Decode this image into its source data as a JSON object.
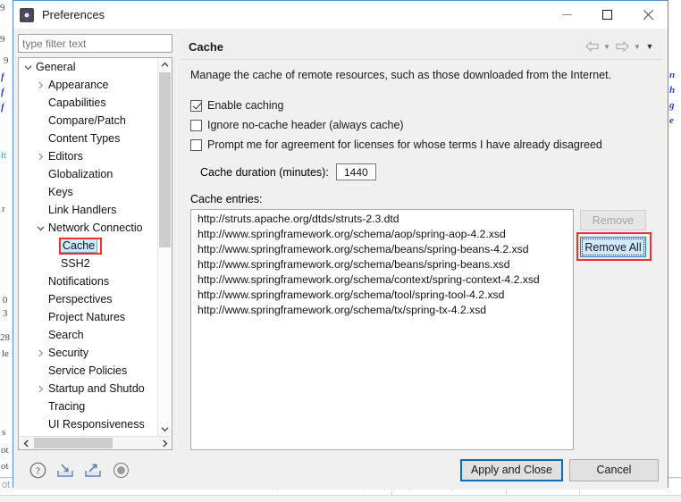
{
  "window": {
    "title": "Preferences",
    "icon": "preferences-gear-icon",
    "minimize_label": "–",
    "maximize_label": "□",
    "close_label": "✕"
  },
  "sidebar": {
    "filter_placeholder": "type filter text",
    "filter_value": "",
    "items": [
      {
        "label": "General",
        "indent": 0,
        "twisty": "expanded",
        "selected": false
      },
      {
        "label": "Appearance",
        "indent": 1,
        "twisty": "collapsed",
        "selected": false
      },
      {
        "label": "Capabilities",
        "indent": 1,
        "twisty": "none",
        "selected": false
      },
      {
        "label": "Compare/Patch",
        "indent": 1,
        "twisty": "none",
        "selected": false
      },
      {
        "label": "Content Types",
        "indent": 1,
        "twisty": "none",
        "selected": false
      },
      {
        "label": "Editors",
        "indent": 1,
        "twisty": "collapsed",
        "selected": false
      },
      {
        "label": "Globalization",
        "indent": 1,
        "twisty": "none",
        "selected": false
      },
      {
        "label": "Keys",
        "indent": 1,
        "twisty": "none",
        "selected": false
      },
      {
        "label": "Link Handlers",
        "indent": 1,
        "twisty": "none",
        "selected": false
      },
      {
        "label": "Network Connectio",
        "indent": 1,
        "twisty": "expanded",
        "selected": false
      },
      {
        "label": "Cache",
        "indent": 2,
        "twisty": "none",
        "selected": true
      },
      {
        "label": "SSH2",
        "indent": 2,
        "twisty": "none",
        "selected": false
      },
      {
        "label": "Notifications",
        "indent": 1,
        "twisty": "none",
        "selected": false
      },
      {
        "label": "Perspectives",
        "indent": 1,
        "twisty": "none",
        "selected": false
      },
      {
        "label": "Project Natures",
        "indent": 1,
        "twisty": "none",
        "selected": false
      },
      {
        "label": "Search",
        "indent": 1,
        "twisty": "none",
        "selected": false
      },
      {
        "label": "Security",
        "indent": 1,
        "twisty": "collapsed",
        "selected": false
      },
      {
        "label": "Service Policies",
        "indent": 1,
        "twisty": "none",
        "selected": false
      },
      {
        "label": "Startup and Shutdo",
        "indent": 1,
        "twisty": "collapsed",
        "selected": false
      },
      {
        "label": "Tracing",
        "indent": 1,
        "twisty": "none",
        "selected": false
      },
      {
        "label": "UI Responsiveness",
        "indent": 1,
        "twisty": "none",
        "selected": false
      }
    ]
  },
  "page": {
    "title": "Cache",
    "nav": {
      "back_icon": "back-arrow-icon",
      "back_caret": "▼",
      "forward_icon": "forward-arrow-icon",
      "forward_caret": "▼",
      "menu_caret": "▼"
    },
    "description": "Manage the cache of remote resources, such as those downloaded from the Internet.",
    "checkboxes": [
      {
        "label": "Enable caching",
        "checked": true
      },
      {
        "label": "Ignore no-cache header (always cache)",
        "checked": false
      },
      {
        "label": "Prompt me for agreement for licenses for whose terms I have already disagreed",
        "checked": false
      }
    ],
    "duration": {
      "label": "Cache duration (minutes):",
      "value": "1440"
    },
    "entries_label": "Cache entries:",
    "entries": [
      "http://struts.apache.org/dtds/struts-2.3.dtd",
      "http://www.springframework.org/schema/aop/spring-aop-4.2.xsd",
      "http://www.springframework.org/schema/beans/spring-beans-4.2.xsd",
      "http://www.springframework.org/schema/beans/spring-beans.xsd",
      "http://www.springframework.org/schema/context/spring-context-4.2.xsd",
      "http://www.springframework.org/schema/tool/spring-tool-4.2.xsd",
      "http://www.springframework.org/schema/tx/spring-tx-4.2.xsd"
    ],
    "buttons": {
      "remove": "Remove",
      "remove_all": "Remove All"
    }
  },
  "footer": {
    "icons": [
      {
        "name": "help-icon"
      },
      {
        "name": "import-icon"
      },
      {
        "name": "export-icon"
      },
      {
        "name": "restore-defaults-icon"
      }
    ],
    "apply_and_close": "Apply and Close",
    "cancel": "Cancel"
  },
  "highlight_color": "#f03030",
  "backdrop": {
    "left_fragments": [
      "9",
      "9",
      "9",
      "f",
      "f",
      "f",
      "it",
      "r",
      "0",
      "3",
      "28",
      "le",
      "s",
      "ot",
      "ot"
    ],
    "right_fragments": [
      "n",
      "h",
      "g",
      "e"
    ],
    "bottom_text": "ot be validated as the XML definition \"http://hibernate.sourceforge.net/hibernate-mapping\"  yingname/s/ejb.li   line 5                XML Problem"
  }
}
